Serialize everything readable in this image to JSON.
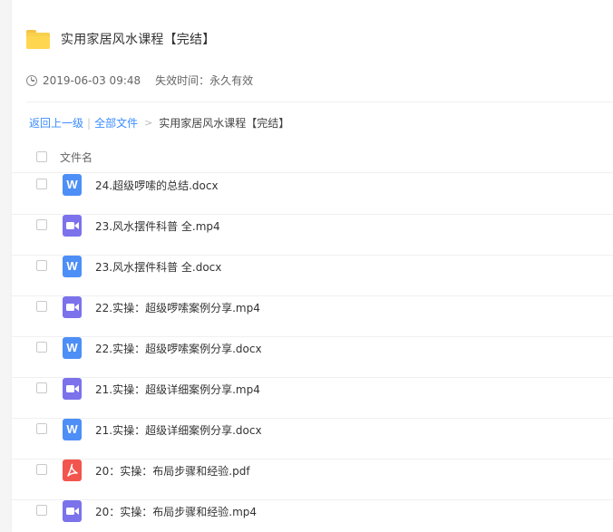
{
  "folder": {
    "title": "实用家居风水课程【完结】",
    "icon": "folder-icon",
    "color": "#ffd64f"
  },
  "meta": {
    "datetime": "2019-06-03 09:48",
    "expire": "失效时间：永久有效"
  },
  "breadcrumb": {
    "back": "返回上一级",
    "sep": "|",
    "all_files": "全部文件",
    "arrow": ">",
    "current": "实用家居风水课程【完结】"
  },
  "list": {
    "column_header": "文件名",
    "files": [
      {
        "name": "24.超级啰嗦的总结.docx",
        "type": "word"
      },
      {
        "name": "23.风水摆件科普 全.mp4",
        "type": "video"
      },
      {
        "name": "23.风水摆件科普 全.docx",
        "type": "word"
      },
      {
        "name": "22.实操：超级啰嗦案例分享.mp4",
        "type": "video"
      },
      {
        "name": "22.实操：超级啰嗦案例分享.docx",
        "type": "word"
      },
      {
        "name": "21.实操：超级详细案例分享.mp4",
        "type": "video"
      },
      {
        "name": "21.实操：超级详细案例分享.docx",
        "type": "word"
      },
      {
        "name": "20：实操：布局步骤和经验.pdf",
        "type": "pdf"
      },
      {
        "name": "20：实操：布局步骤和经验.mp4",
        "type": "video"
      }
    ]
  },
  "icons": {
    "word": {
      "name": "word-file-icon",
      "glyph": "W",
      "color": "#4e8ef7"
    },
    "video": {
      "name": "video-file-icon",
      "color": "#7b72ec"
    },
    "pdf": {
      "name": "pdf-file-icon",
      "color": "#f2554e"
    }
  },
  "colors": {
    "link": "#3b8cff",
    "text": "#333333",
    "muted": "#666666"
  }
}
